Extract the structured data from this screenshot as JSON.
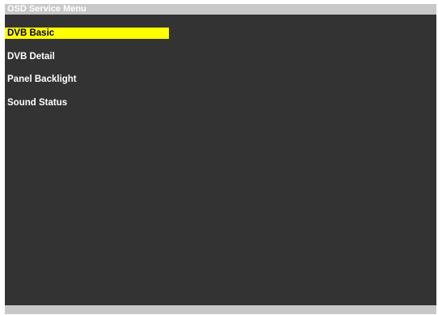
{
  "header": {
    "title": "OSD Service Menu"
  },
  "menu": {
    "selected_index": 0,
    "items": [
      {
        "label": "DVB Basic"
      },
      {
        "label": "DVB Detail"
      },
      {
        "label": "Panel Backlight"
      },
      {
        "label": "Sound Status"
      }
    ]
  },
  "colors": {
    "background": "#333333",
    "bar": "#c8c8c8",
    "highlight": "#ffff00",
    "text": "#ffffff",
    "highlight_text": "#000000"
  }
}
